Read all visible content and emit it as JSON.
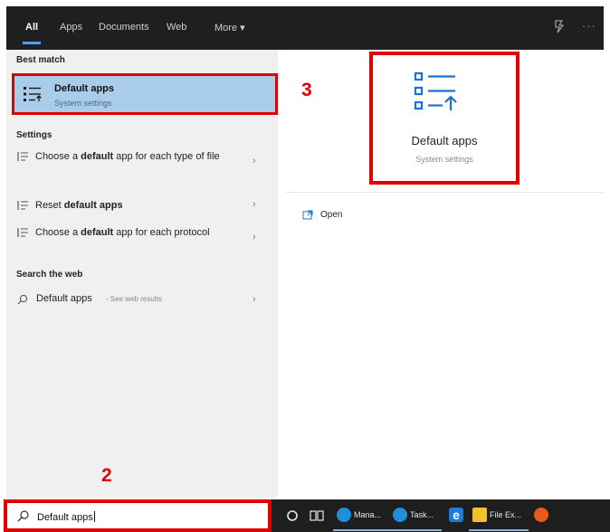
{
  "tabs": [
    "All",
    "Apps",
    "Documents",
    "Web",
    "More"
  ],
  "active_tab": "All",
  "best_match": {
    "heading": "Best match",
    "title": "Default apps",
    "subtitle": "System settings"
  },
  "settings": {
    "heading": "Settings",
    "items": [
      {
        "pre": "Choose a ",
        "bold": "default",
        "post": " app for each type of file"
      },
      {
        "pre": "Reset ",
        "bold": "default apps",
        "post": ""
      },
      {
        "pre": "Choose a ",
        "bold": "default",
        "post": " app for each protocol"
      }
    ]
  },
  "web": {
    "heading": "Search the web",
    "query": "Default apps",
    "suffix": "- See web results"
  },
  "detail": {
    "title": "Default apps",
    "subtitle": "System settings",
    "action": "Open"
  },
  "annotations": {
    "step_2": "2",
    "step_3": "3"
  },
  "search": {
    "value": "Default apps"
  },
  "taskbar": {
    "apps": [
      {
        "label": "Mana...",
        "color": "#1e8fd8"
      },
      {
        "label": "Task...",
        "color": "#1e8fd8"
      },
      {
        "label": "",
        "color": "#1f7ad8"
      },
      {
        "label": "File Ex...",
        "color": "#f2c12e"
      },
      {
        "label": "",
        "color": "#e85a1a"
      }
    ]
  },
  "colors": {
    "highlight": "#a8ccea",
    "annotation": "#e00000",
    "accent": "#4aa0ff",
    "dark": "#1f1f1f"
  }
}
